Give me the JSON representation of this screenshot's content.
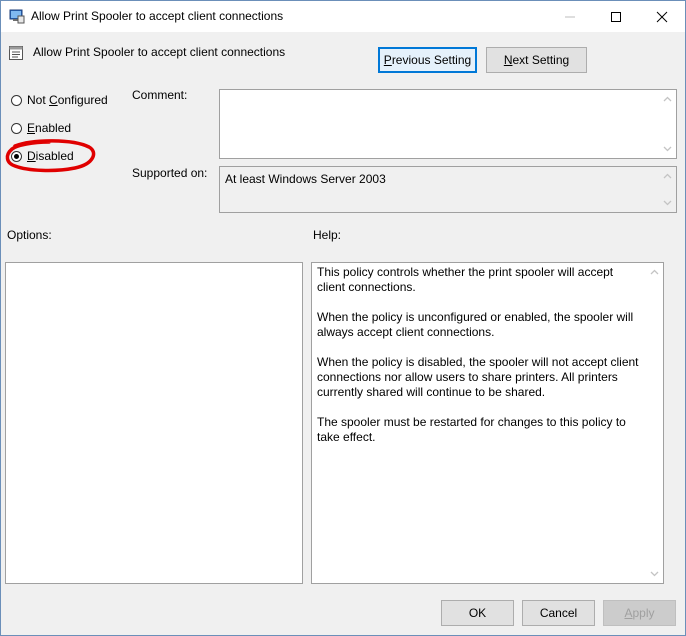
{
  "window": {
    "title": "Allow Print Spooler to accept client connections"
  },
  "header": {
    "title": "Allow Print Spooler to accept client connections",
    "previous_setting": {
      "accel": "P",
      "rest": "revious Setting"
    },
    "next_setting": {
      "accel": "N",
      "rest": "ext Setting"
    }
  },
  "state": {
    "options": [
      {
        "label_pre": "Not ",
        "accel": "C",
        "label_post": "onfigured",
        "checked": false
      },
      {
        "label_pre": "",
        "accel": "E",
        "label_post": "nabled",
        "checked": false
      },
      {
        "label_pre": "",
        "accel": "D",
        "label_post": "isabled",
        "checked": true
      }
    ],
    "selected": "Disabled"
  },
  "comment": {
    "label": "Comment:",
    "value": ""
  },
  "supported_on": {
    "label": "Supported on:",
    "value": "At least Windows Server 2003"
  },
  "options_pane": {
    "label": "Options:"
  },
  "help_pane": {
    "label": "Help:",
    "paragraphs": [
      "This policy controls whether the print spooler will accept client connections.",
      "When the policy is unconfigured or enabled, the spooler will always accept client connections.",
      "When the policy is disabled, the spooler will not accept client connections nor allow users to share printers.  All printers currently shared will continue to be shared.",
      "The spooler must be restarted for changes to this policy to take effect."
    ]
  },
  "footer": {
    "ok": "OK",
    "cancel": "Cancel",
    "apply": {
      "accel": "A",
      "rest": "pply"
    }
  },
  "annotation": {
    "color": "#e00000"
  }
}
